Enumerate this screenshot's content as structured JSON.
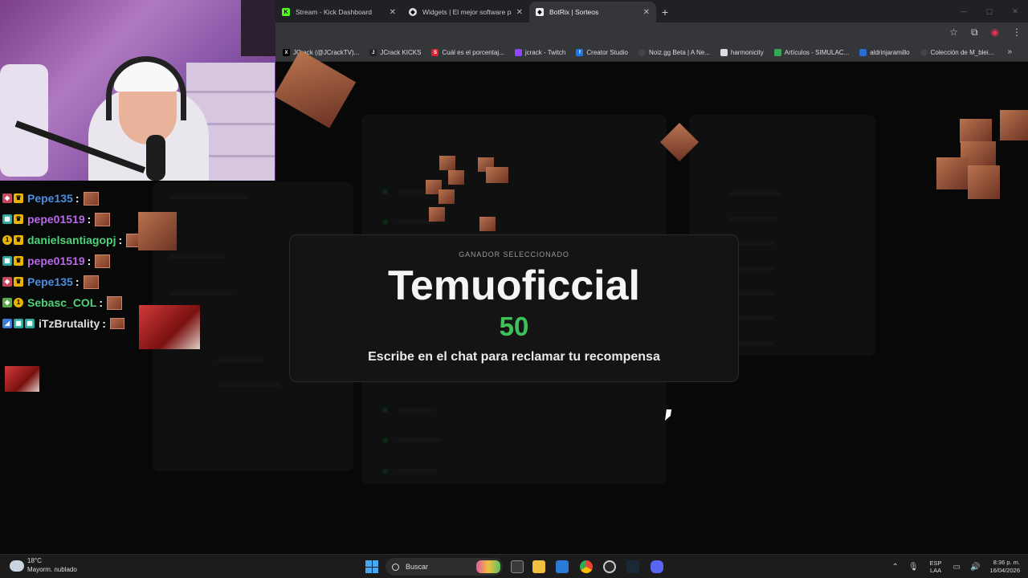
{
  "browser": {
    "tabs": [
      {
        "title": "Stream - Kick Dashboard",
        "icon": "kick-icon",
        "active": false
      },
      {
        "title": "Widgets | El mejor software pa",
        "icon": "widgets-icon",
        "active": false
      },
      {
        "title": "BotRix | Sorteos",
        "icon": "botrix-icon",
        "active": true
      }
    ],
    "new_tab": "+",
    "bookmarks": [
      {
        "label": "JCrack (@JCrackTV)...",
        "icon": "x-icon",
        "color": "#000000"
      },
      {
        "label": "JCrack KICKS",
        "icon": "jcrack-icon",
        "color": "#222222"
      },
      {
        "label": "Cuál es el porcentaj...",
        "icon": "s-icon",
        "color": "#d9232e"
      },
      {
        "label": "jcrack - Twitch",
        "icon": "twitch-icon",
        "color": "#9146ff"
      },
      {
        "label": "Creator Studio",
        "icon": "facebook-icon",
        "color": "#1877f2"
      },
      {
        "label": "Noiz.gg Beta | A Ne...",
        "icon": "noiz-icon",
        "color": "#444444"
      },
      {
        "label": "harmonicity",
        "icon": "harmonicity-icon",
        "color": "#dddddd"
      },
      {
        "label": "Artículos - SIMULAC...",
        "icon": "drive-icon",
        "color": "#34a853"
      },
      {
        "label": "aldrinjaramillo",
        "icon": "aldrin-icon",
        "color": "#2b6ad0"
      },
      {
        "label": "Colección de M_blei...",
        "icon": "coleccion-icon",
        "color": "#444444"
      }
    ]
  },
  "modal": {
    "label": "GANADOR SELECCIONADO",
    "winner": "Temuoficcial",
    "score": "50",
    "message": "Escribe en el chat para reclamar tu recompensa",
    "score_color": "#3fc15a"
  },
  "chat": [
    {
      "user": "Pepe135",
      "color": "#4a8fe0",
      "badges": [
        "#c8485a",
        "#e8b400"
      ]
    },
    {
      "user": "pepe01519",
      "color": "#b86ae8",
      "badges": [
        "#2aa8a0",
        "#e8b400"
      ]
    },
    {
      "user": "danielsantiagopj",
      "color": "#4fd47a",
      "badges": [
        "#e8b400",
        "#e8b400"
      ]
    },
    {
      "user": "pepe01519",
      "color": "#b86ae8",
      "badges": [
        "#2aa8a0",
        "#e8b400"
      ]
    },
    {
      "user": "Pepe135",
      "color": "#4a8fe0",
      "badges": [
        "#c8485a",
        "#e8b400"
      ]
    },
    {
      "user": "Sebasc_COL",
      "color": "#4fd47a",
      "badges": [
        "#5aa84a",
        "#e8b400"
      ]
    },
    {
      "user": "iTzBrutality",
      "color": "#e0e0e0",
      "badges": [
        "#3a7ad8",
        "#2aa8a0",
        "#2aa8a0"
      ]
    }
  ],
  "taskbar": {
    "temperature": "18°C",
    "condition": "Mayorm. nublado",
    "search_placeholder": "Buscar",
    "lang_top": "ESP",
    "lang_bottom": "LAA",
    "time": "8:36 p. m.",
    "date": "16/04/2026"
  }
}
